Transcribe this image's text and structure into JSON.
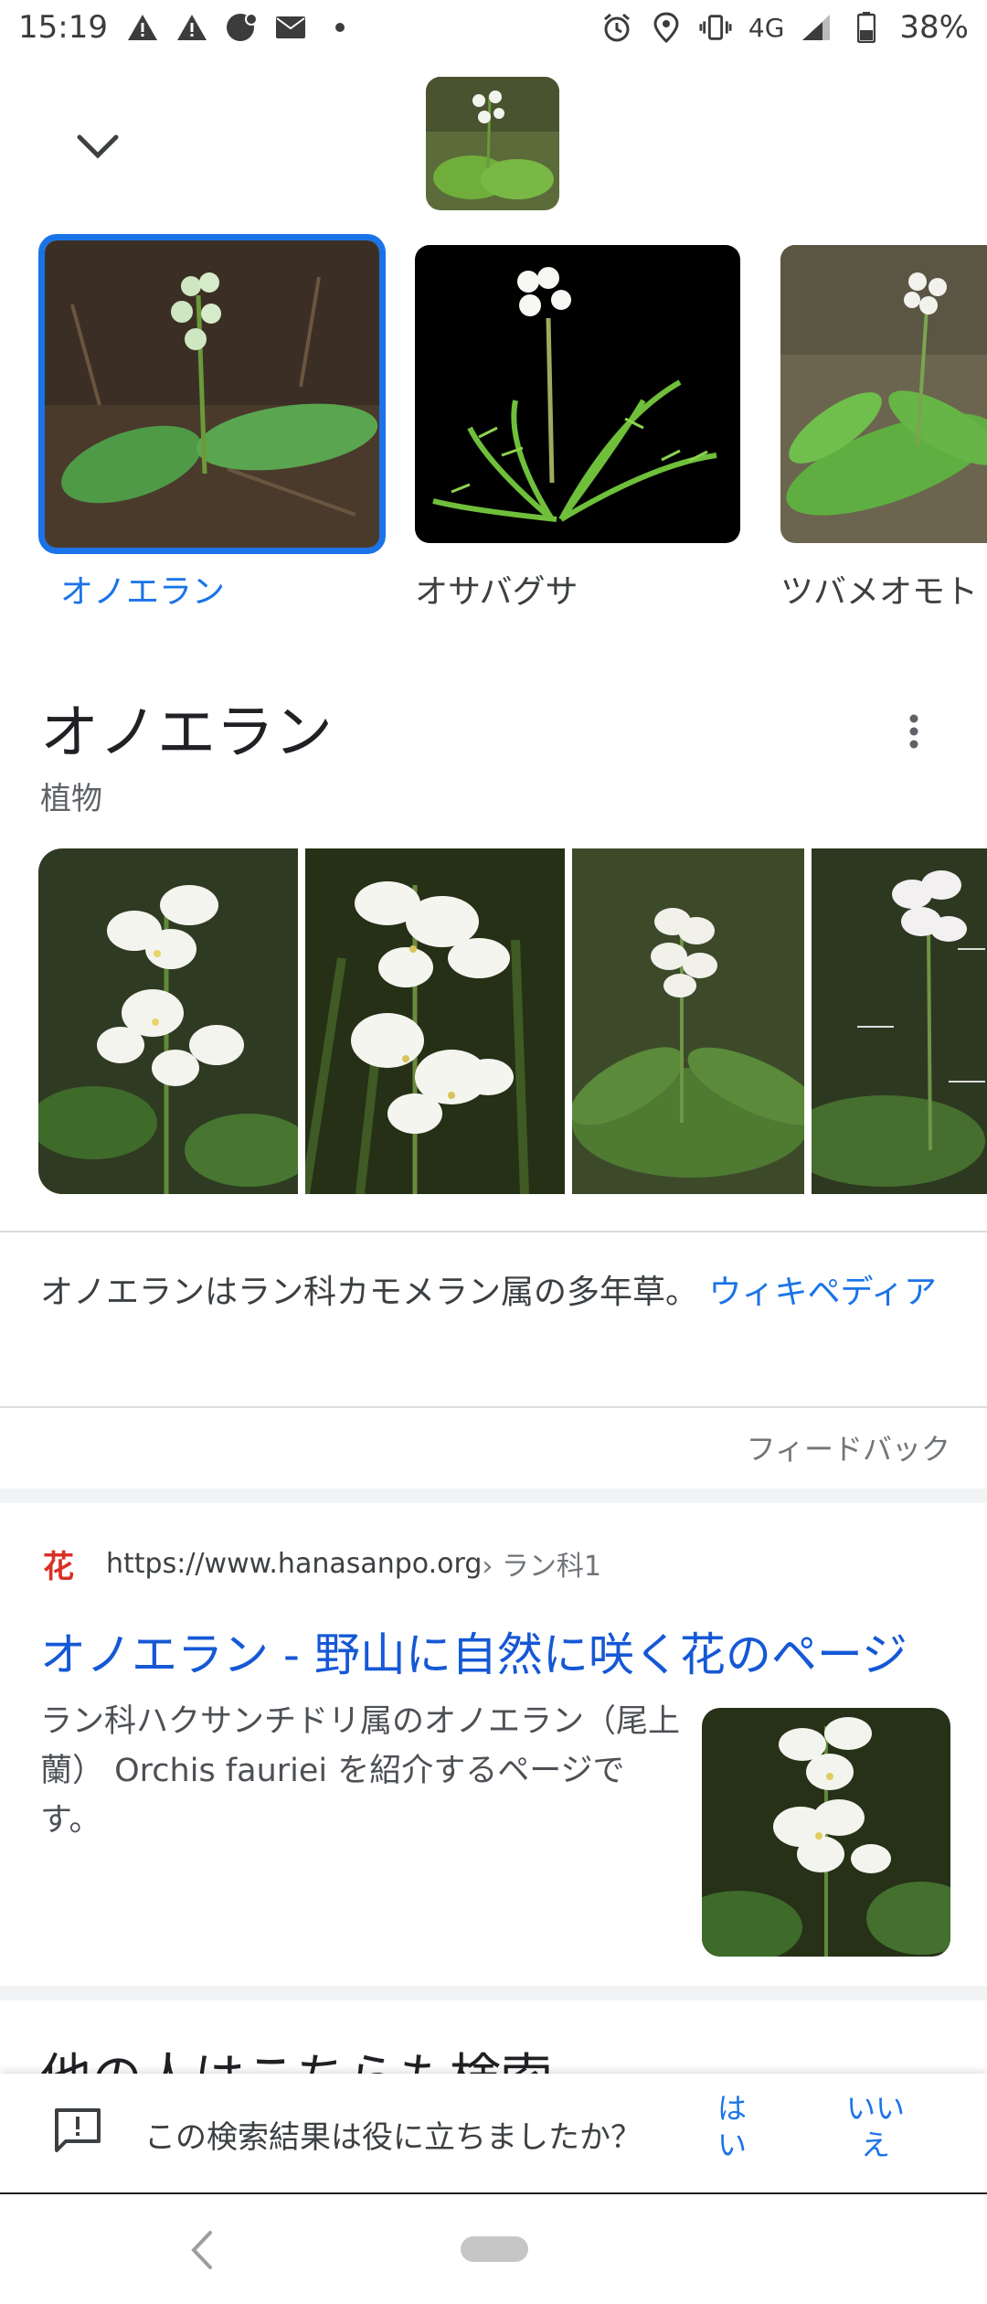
{
  "status_bar": {
    "time": "15:19",
    "network": "4G",
    "battery": "38%"
  },
  "carousel": {
    "items": [
      {
        "label": "オノエラン",
        "selected": true
      },
      {
        "label": "オサバグサ",
        "selected": false
      },
      {
        "label": "ツバメオモト",
        "selected": false
      }
    ]
  },
  "entity": {
    "title": "オノエラン",
    "subtitle": "植物"
  },
  "description": {
    "text": "オノエランはラン科カモメラン属の多年草。",
    "source_link": "ウィキペディア"
  },
  "feedback_link": "フィードバック",
  "result": {
    "favicon": "花",
    "url": "https://www.hanasanpo.org",
    "breadcrumb": " › ラン科1",
    "title": "オノエラン - 野山に自然に咲く花のページ",
    "snippet": "ラン科ハクサンチドリ属のオノエラン（尾上蘭） Orchis fauriei を紹介するページです。"
  },
  "partial_heading": "他の人はこちらも検索",
  "feedback_bar": {
    "question": "この検索結果は役に立ちましたか？",
    "yes": "はい",
    "no": "いいえ"
  },
  "colors": {
    "accent": "#1a73e8",
    "link": "#1558d6"
  }
}
